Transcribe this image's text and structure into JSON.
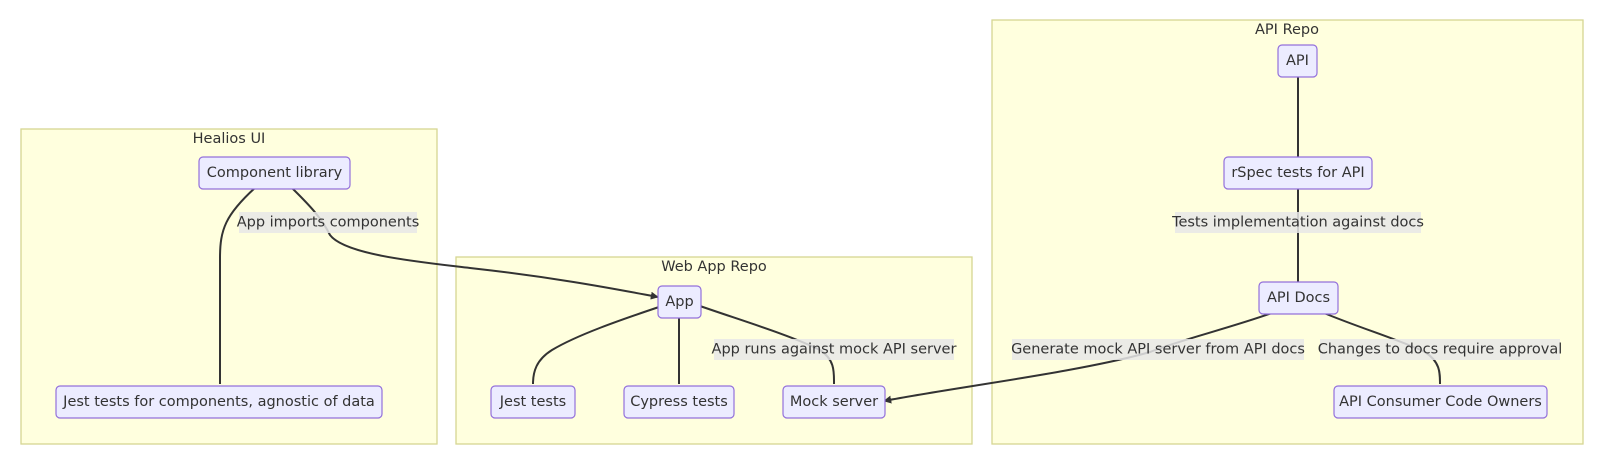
{
  "clusters": {
    "healios": {
      "label": "Healios UI"
    },
    "webapp": {
      "label": "Web App Repo"
    },
    "api_repo": {
      "label": "API Repo"
    }
  },
  "nodes": {
    "component_library": {
      "label": "Component library"
    },
    "jest_components": {
      "label": "Jest tests for components, agnostic of data"
    },
    "app": {
      "label": "App"
    },
    "jest_tests": {
      "label": "Jest tests"
    },
    "cypress_tests": {
      "label": "Cypress tests"
    },
    "mock_server": {
      "label": "Mock server"
    },
    "api": {
      "label": "API"
    },
    "rspec": {
      "label": "rSpec tests for API"
    },
    "api_docs": {
      "label": "API Docs"
    },
    "code_owners": {
      "label": "API Consumer Code Owners"
    }
  },
  "edges": {
    "app_imports": {
      "label": "App imports components"
    },
    "mock_api_server": {
      "label": "App runs against mock API server"
    },
    "tests_impl": {
      "label": "Tests implementation against docs"
    },
    "generate_mock": {
      "label": "Generate mock API server from API docs"
    },
    "docs_approval": {
      "label": "Changes to docs require approval"
    }
  }
}
